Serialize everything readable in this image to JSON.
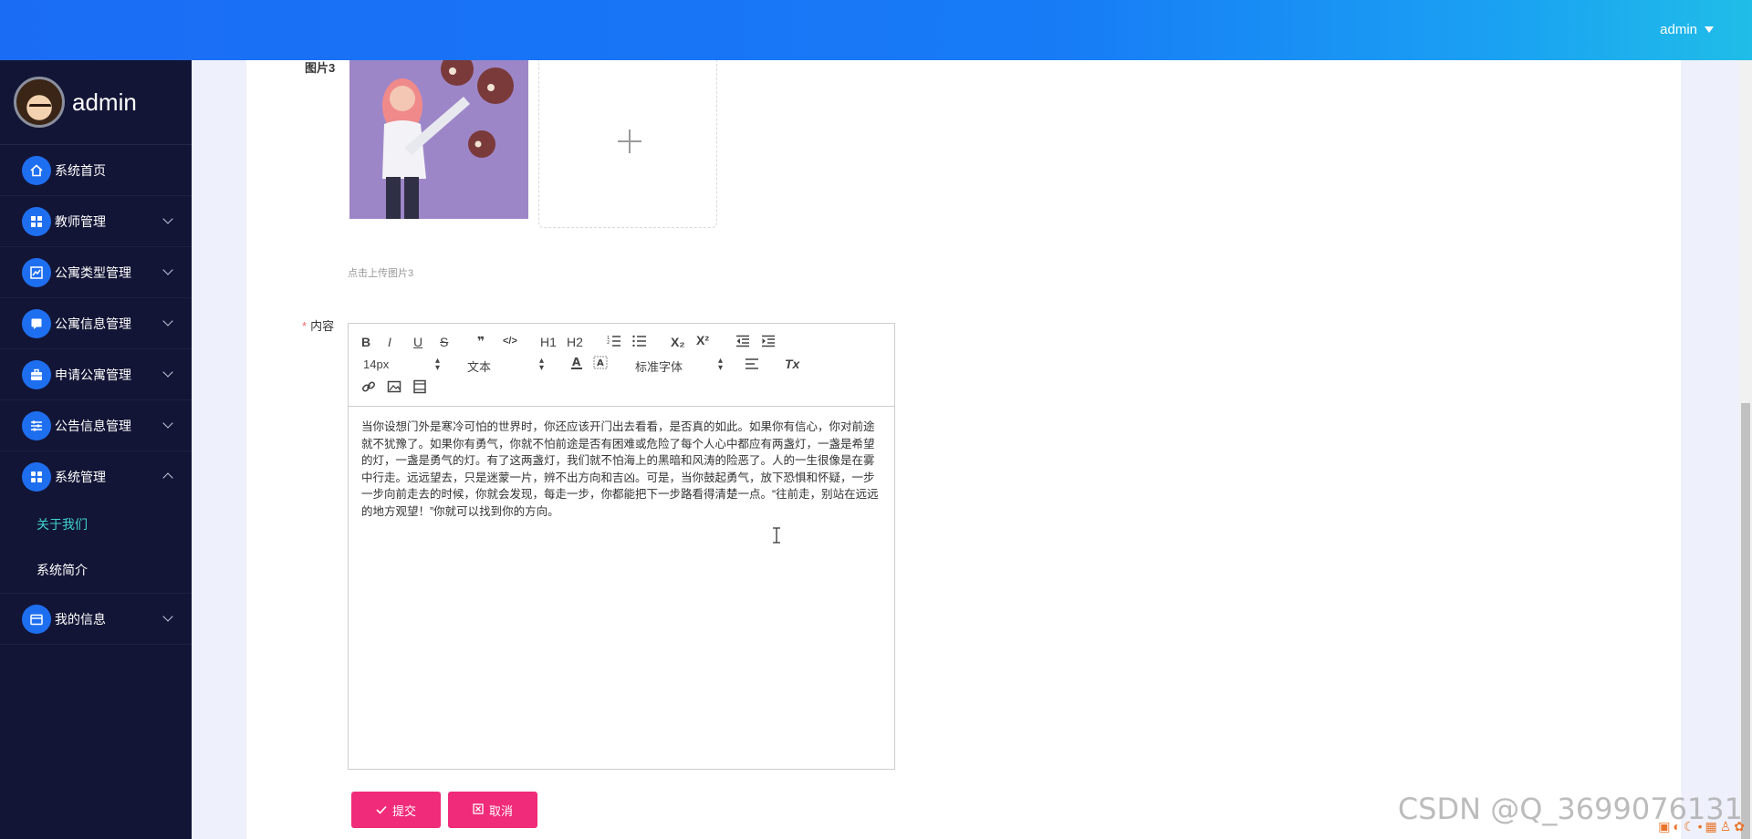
{
  "header": {
    "user": "admin",
    "user_caret_icon": "caret-down-icon"
  },
  "sidebar": {
    "profile_name": "admin",
    "items": [
      {
        "label": "系统首页",
        "icon": "home-icon"
      },
      {
        "label": "教师管理",
        "icon": "grid-icon"
      },
      {
        "label": "公寓类型管理",
        "icon": "chart-icon"
      },
      {
        "label": "公寓信息管理",
        "icon": "chat-icon"
      },
      {
        "label": "申请公寓管理",
        "icon": "briefcase-icon"
      },
      {
        "label": "公告信息管理",
        "icon": "sliders-icon"
      },
      {
        "label": "系统管理",
        "icon": "grid-icon"
      },
      {
        "label": "我的信息",
        "icon": "wallet-icon"
      }
    ],
    "submenu": [
      {
        "label": "关于我们",
        "active": true
      },
      {
        "label": "系统简介",
        "active": false
      }
    ],
    "accent_color": "#1e6ff0",
    "active_color": "#3fd2ce"
  },
  "form": {
    "image3_label": "图片3",
    "upload_hint": "点击上传图片3",
    "content_label": "内容",
    "required_mark": "*"
  },
  "editor": {
    "font_size": "14px",
    "heading": "文本",
    "font_family": "标准字体",
    "toolbar": {
      "bold": "B",
      "italic": "I",
      "underline": "U",
      "strike": "S",
      "quote": "❞",
      "code": "</>",
      "h1": "H1",
      "h2": "H2",
      "sub": "X₂",
      "sup": "X²",
      "clear": "Tx"
    },
    "content": "当你设想门外是寒冷可怕的世界时，你还应该开门出去看看，是否真的如此。如果你有信心，你对前途就不犹豫了。如果你有勇气，你就不怕前途是否有困难或危险了每个人心中都应有两盏灯，一盏是希望的灯，一盏是勇气的灯。有了这两盏灯，我们就不怕海上的黑暗和风涛的险恶了。人的一生很像是在雾中行走。远远望去，只是迷蒙一片，辨不出方向和吉凶。可是，当你鼓起勇气，放下恐惧和怀疑，一步一步向前走去的时候，你就会发现，每走一步，你都能把下一步路看得清楚一点。“往前走，别站在远远的地方观望！”你就可以找到你的方向。"
  },
  "buttons": {
    "submit": "提交",
    "cancel": "取消",
    "color": "#ef2b7a"
  },
  "watermark": "CSDN @Q_3699076131"
}
